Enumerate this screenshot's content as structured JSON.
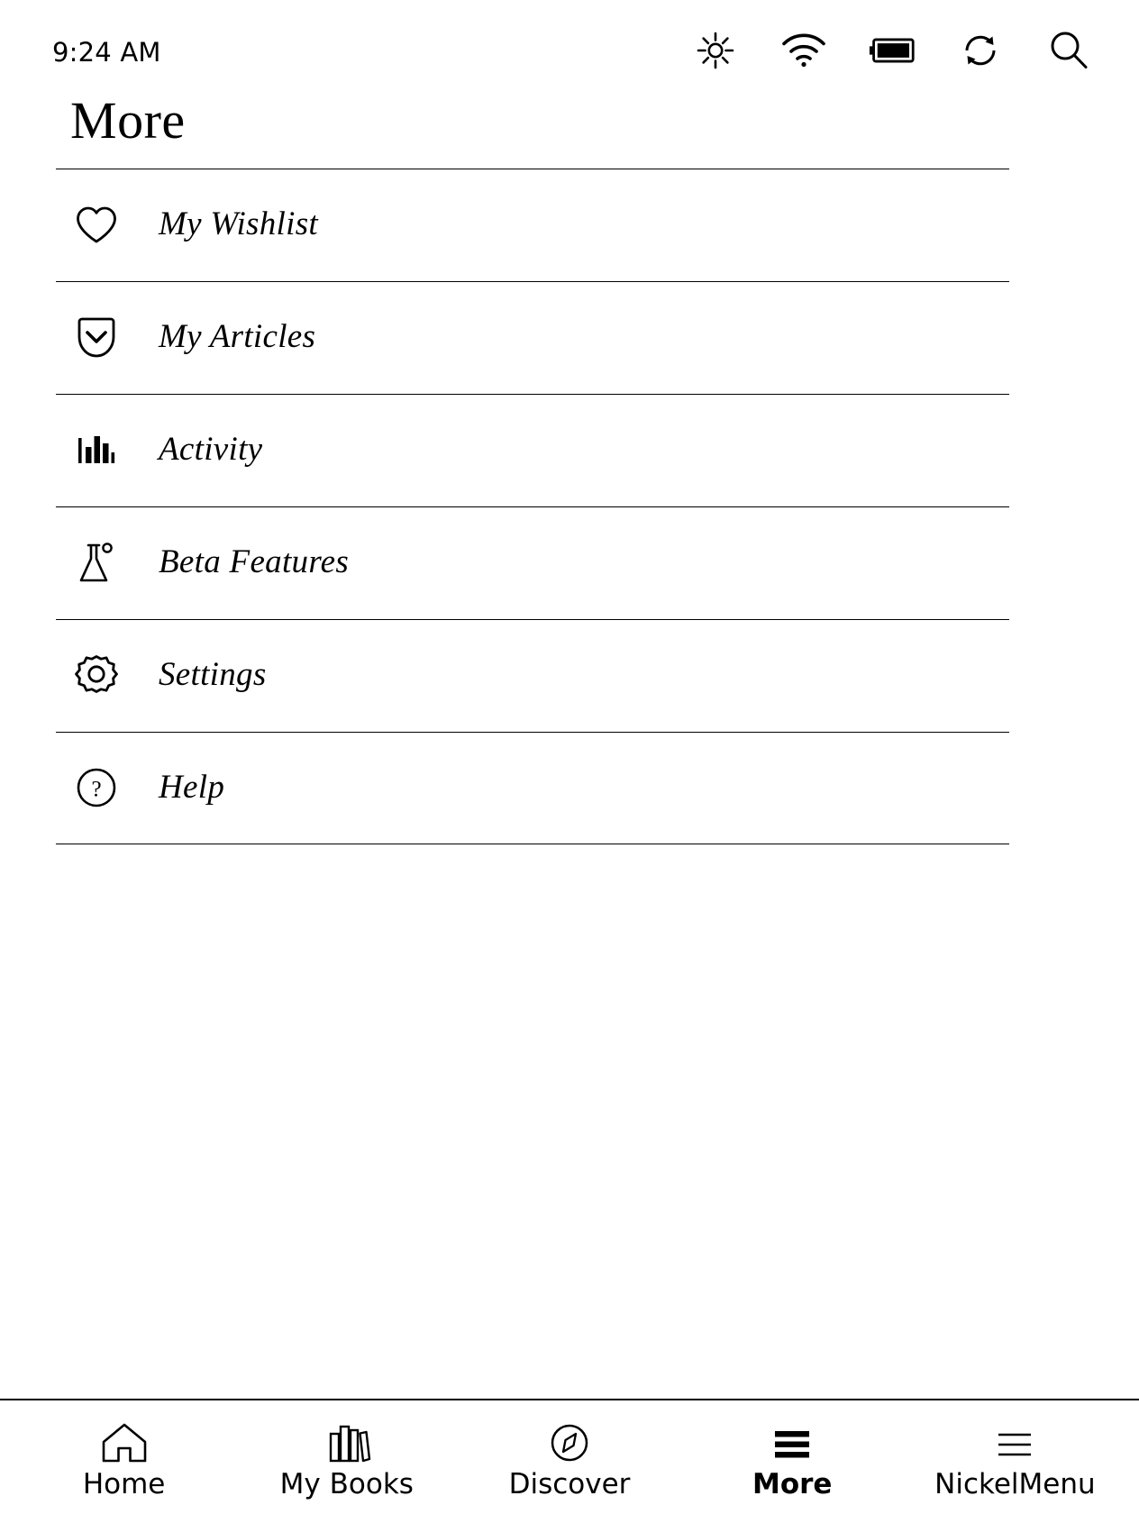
{
  "statusbar": {
    "time": "9:24 AM",
    "icons": [
      {
        "name": "brightness-icon",
        "label": "Brightness"
      },
      {
        "name": "wifi-icon",
        "label": "Wi-Fi"
      },
      {
        "name": "battery-icon",
        "label": "Battery"
      },
      {
        "name": "sync-icon",
        "label": "Sync"
      },
      {
        "name": "search-icon",
        "label": "Search"
      }
    ]
  },
  "header": {
    "title": "More"
  },
  "menu": {
    "items": [
      {
        "label": "My Wishlist",
        "icon": "heart-icon"
      },
      {
        "label": "My Articles",
        "icon": "pocket-icon"
      },
      {
        "label": "Activity",
        "icon": "bar-chart-icon"
      },
      {
        "label": "Beta Features",
        "icon": "flask-icon"
      },
      {
        "label": "Settings",
        "icon": "gear-icon"
      },
      {
        "label": "Help",
        "icon": "question-circle-icon"
      }
    ]
  },
  "navbar": {
    "items": [
      {
        "label": "Home",
        "icon": "home-icon",
        "active": false
      },
      {
        "label": "My Books",
        "icon": "books-icon",
        "active": false
      },
      {
        "label": "Discover",
        "icon": "compass-icon",
        "active": false
      },
      {
        "label": "More",
        "icon": "hamburger-icon",
        "active": true
      },
      {
        "label": "NickelMenu",
        "icon": "menu-lines-icon",
        "active": false
      }
    ]
  },
  "colors": {
    "foreground": "#000000",
    "background": "#ffffff"
  }
}
